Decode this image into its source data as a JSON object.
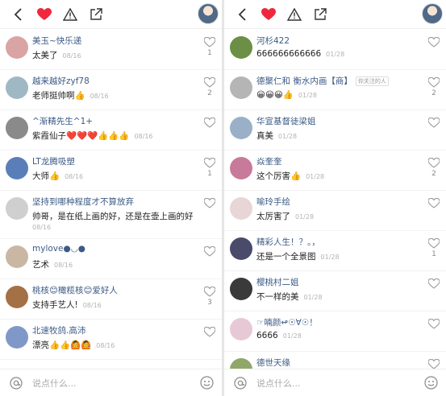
{
  "left": {
    "input_placeholder": "说点什么...",
    "comments": [
      {
        "name": "美玉~快乐递",
        "text": "太美了",
        "date": "08/16",
        "likes": "1",
        "avatar_color": "#d9a4a4",
        "tall": false
      },
      {
        "name": "越来越好zyf78",
        "text": "老师挺帅啊👍",
        "date": "08/16",
        "likes": "2",
        "avatar_color": "#9fb8c4",
        "tall": false
      },
      {
        "name": "^渐精先生^1+",
        "text": "紫霞仙子❤️❤️❤️👍👍👍",
        "date": "08/16",
        "likes": "",
        "avatar_color": "#8a8a8a",
        "tall": false
      },
      {
        "name": "LT龙腾吸塑",
        "text": "大师👍",
        "date": "08/16",
        "likes": "1",
        "avatar_color": "#5a7fb8",
        "tall": false
      },
      {
        "name": "坚持到哪种程度才不算放弃",
        "text": "帅哥，是在纸上画的好，还是在壶上画的好",
        "date": "08/16",
        "likes": "",
        "avatar_color": "#cfcfcf",
        "tall": true
      },
      {
        "name": "mylove●◡●",
        "text": "艺术",
        "date": "08/16",
        "likes": "",
        "avatar_color": "#c9b7a4",
        "tall": false
      },
      {
        "name": "桃核😊橄榄核😊爱好人",
        "text": "支持手艺人!",
        "date": "08/16",
        "likes": "3",
        "avatar_color": "#a47045",
        "tall": false
      },
      {
        "name": "北速牧鸽.高沛",
        "text": "漂亮👍👍🙆🙆",
        "date": "08/16",
        "likes": "",
        "avatar_color": "#7f98c7",
        "tall": false
      }
    ]
  },
  "right": {
    "input_placeholder": "说点什么...",
    "comments": [
      {
        "name": "河杉422",
        "text": "666666666666",
        "date": "01/28",
        "likes": "",
        "avatar_color": "#6b8f45",
        "tall": false,
        "tag": ""
      },
      {
        "name": "德聚仁和 衡水内画【商】",
        "text": "😀😀😀👍",
        "date": "01/28",
        "likes": "2",
        "avatar_color": "#b5b5b5",
        "tall": false,
        "tag": "你关注的人"
      },
      {
        "name": "华宣基督徒梁姐",
        "text": "真美",
        "date": "01/28",
        "likes": "",
        "avatar_color": "#9ab0c8",
        "tall": false,
        "tag": ""
      },
      {
        "name": "焱奎奎",
        "text": "这个厉害👍",
        "date": "01/28",
        "likes": "2",
        "avatar_color": "#c87a9a",
        "tall": false,
        "tag": ""
      },
      {
        "name": "喻玲手绘",
        "text": "太厉害了",
        "date": "01/28",
        "likes": "",
        "avatar_color": "#e8d6d6",
        "tall": false,
        "tag": ""
      },
      {
        "name": "精彩人生！？。，",
        "text": "还是一个全景图",
        "date": "01/28",
        "likes": "1",
        "avatar_color": "#4a4a6a",
        "tall": false,
        "tag": ""
      },
      {
        "name": "樱桃村二姐",
        "text": "不一样的美",
        "date": "01/28",
        "likes": "",
        "avatar_color": "#3a3a3a",
        "tall": false,
        "tag": ""
      },
      {
        "name": "☞喃颜↫☉∀☉！",
        "text": "6666",
        "date": "01/28",
        "likes": "",
        "avatar_color": "#e7c9d6",
        "tall": false,
        "tag": ""
      },
      {
        "name": "德世天缘",
        "text": "",
        "date": "",
        "likes": "",
        "avatar_color": "#8fa86a",
        "tall": false,
        "tag": ""
      }
    ]
  },
  "icons": {
    "back": "chevron-left-icon",
    "like": "heart-filled-icon",
    "report": "warning-triangle-icon",
    "share": "share-icon",
    "mention": "at-icon",
    "emoji": "smile-icon",
    "comment_like": "heart-outline-icon"
  },
  "colors": {
    "accent_red": "#f0283c",
    "name_blue": "#3b5a85"
  }
}
